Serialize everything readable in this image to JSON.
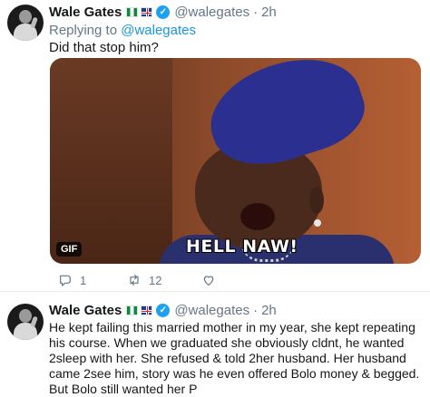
{
  "tweets": [
    {
      "name": "Wale Gates",
      "handle": "@walegates",
      "dot": "·",
      "time": "2h",
      "replying_prefix": "Replying to ",
      "replying_to": "@walegates",
      "text": "Did that stop him?",
      "media": {
        "caption": "HELL NAW!",
        "badge": "GIF"
      },
      "actions": {
        "replies": "1",
        "retweets": "12",
        "likes": ""
      }
    },
    {
      "name": "Wale Gates",
      "handle": "@walegates",
      "dot": "·",
      "time": "2h",
      "text": "He kept failing this married mother in my year, she kept repeating his course. When we graduated she obviously cldnt, he wanted 2sleep with her. She refused & told 2her husband. Her husband came 2see him, story was he even offered Bolo money & begged.\nBut Bolo still wanted her P"
    }
  ],
  "icons": {
    "reply": "reply-icon",
    "retweet": "retweet-icon",
    "like": "heart-icon",
    "verified": "verified-badge-icon"
  },
  "colors": {
    "link": "#1b95e0",
    "muted": "#657786",
    "verified": "#1da1f2"
  }
}
